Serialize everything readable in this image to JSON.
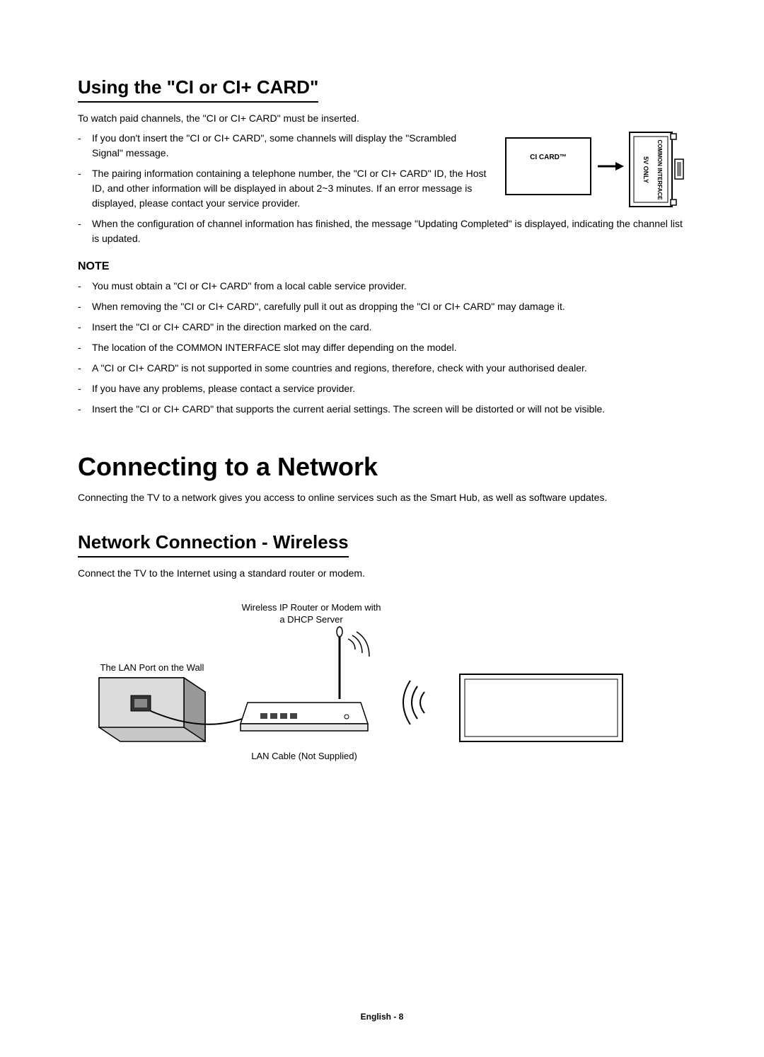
{
  "section1": {
    "title": "Using the \"CI or CI+ CARD\"",
    "intro": "To watch paid channels, the \"CI or CI+ CARD\" must be inserted.",
    "bullets": [
      "If you don't insert the \"CI or CI+ CARD\", some channels will display the \"Scrambled Signal\" message.",
      "The pairing information containing a telephone number, the \"CI or CI+ CARD\" ID, the Host ID, and other information will be displayed in about 2~3 minutes. If an error message is displayed, please contact your service provider.",
      "When the configuration of channel information has finished, the message \"Updating Completed\" is displayed, indicating the channel list is updated."
    ],
    "diagram": {
      "card_label": "CI CARD™",
      "slot_label_5v": "5V ONLY",
      "slot_label_ci": "COMMON INTERFACE"
    },
    "note_heading": "NOTE",
    "note_bullets": [
      "You must obtain a \"CI or CI+ CARD\" from a local cable service provider.",
      "When removing the \"CI or CI+ CARD\", carefully pull it out as dropping the \"CI or CI+ CARD\" may damage it.",
      "Insert the \"CI or CI+ CARD\" in the direction marked on the card.",
      "The location of the COMMON INTERFACE slot may differ depending on the model.",
      "A \"CI or CI+ CARD\" is not supported in some countries and regions, therefore, check with your authorised dealer.",
      "If you have any problems, please contact a service provider.",
      "Insert the \"CI or CI+ CARD\" that supports the current aerial settings. The screen will be distorted or will not be visible."
    ]
  },
  "section2": {
    "heading": "Connecting to a Network",
    "intro": "Connecting the TV to a network gives you access to online services such as the Smart Hub, as well as software updates.",
    "sub_title": "Network Connection - Wireless",
    "sub_intro": "Connect the TV to the Internet using a standard router or modem.",
    "diagram": {
      "router_label": "Wireless IP Router or Modem with a DHCP Server",
      "lan_port_label": "The LAN Port on the Wall",
      "lan_cable_label": "LAN Cable (Not Supplied)"
    }
  },
  "footer": "English - 8"
}
